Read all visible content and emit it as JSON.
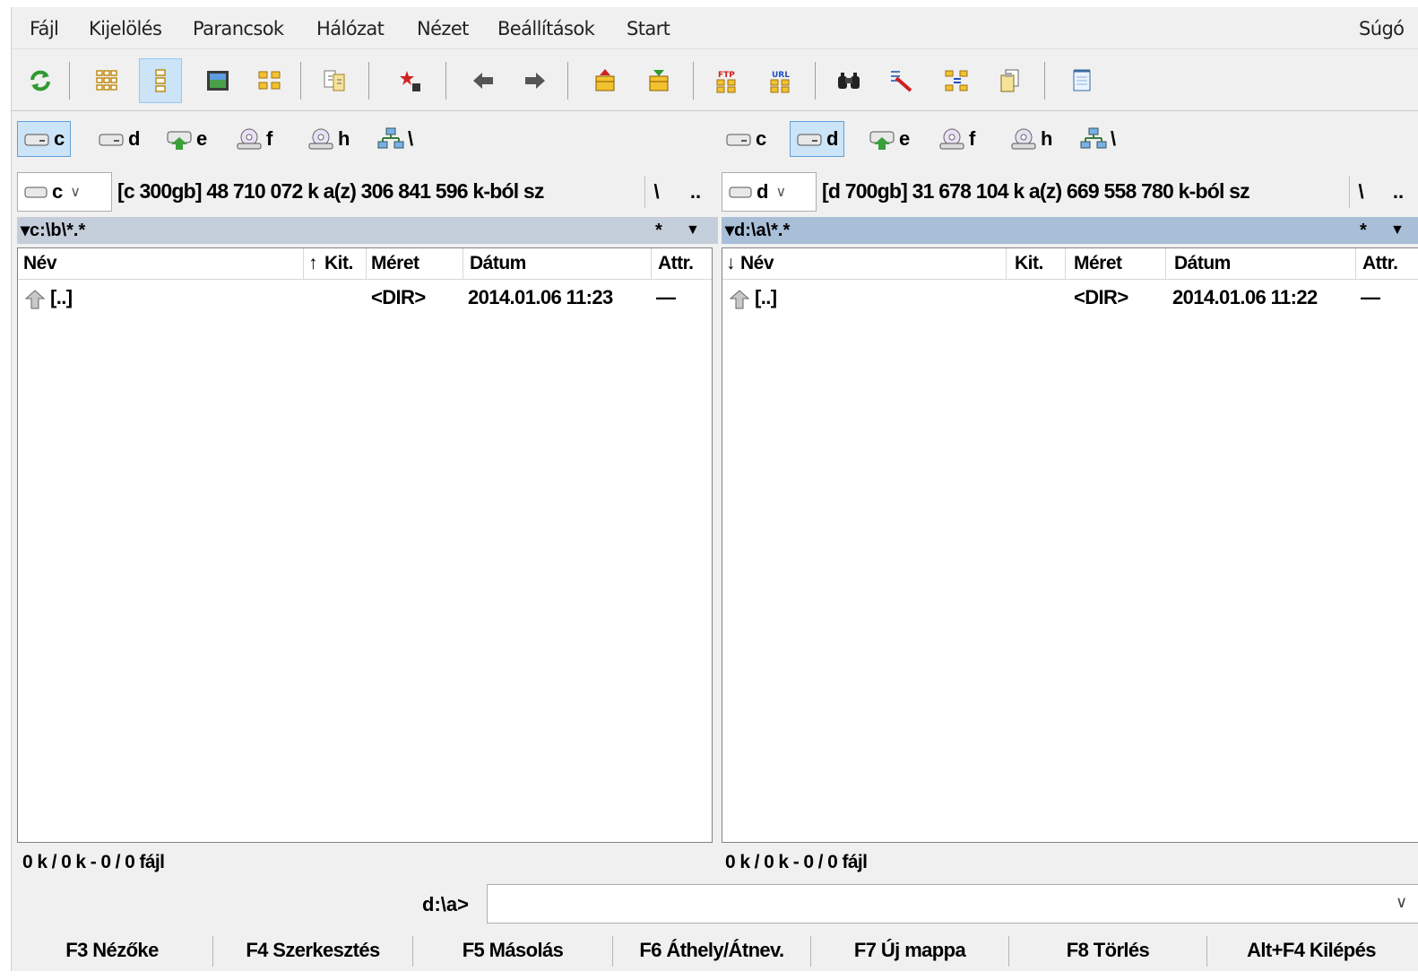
{
  "menu": [
    "Fájl",
    "Kijelölés",
    "Parancsok",
    "Hálózat",
    "Nézet",
    "Beállítások",
    "Start",
    "Súgó"
  ],
  "toolbar": {
    "icons": [
      "refresh-icon",
      "brief-view-icon",
      "detailed-view-icon",
      "thumbnail-view-icon",
      "tree-view-icon",
      "compare-icon",
      "select-icon",
      "back-icon",
      "forward-icon",
      "pack-icon",
      "unpack-icon",
      "ftp-icon",
      "url-icon",
      "search-icon",
      "rename-icon",
      "sync-icon",
      "copy-names-icon",
      "notepad-icon"
    ]
  },
  "left": {
    "drives": [
      {
        "letter": "c",
        "icon": "hdd-icon",
        "active": true
      },
      {
        "letter": "d",
        "icon": "hdd-icon",
        "active": false
      },
      {
        "letter": "e",
        "icon": "removable-drive-icon",
        "active": false
      },
      {
        "letter": "f",
        "icon": "cd-drive-icon",
        "active": false
      },
      {
        "letter": "h",
        "icon": "cd-drive-icon",
        "active": false
      },
      {
        "letter": "\\",
        "icon": "network-icon",
        "active": false
      }
    ],
    "combo_drive": "c",
    "info": "[c 300gb]  48 710 072 k a(z) 306 841 596 k-ból sz",
    "root_btn": "\\",
    "up_btn": "..",
    "path": "▾c:\\b\\*.*",
    "filter": "*",
    "columns": {
      "name": "Név",
      "ext": "Kit.",
      "size": "Méret",
      "date": "Dátum",
      "attr": "Attr."
    },
    "sort_indicator": "ext-asc",
    "rows": [
      {
        "name": "[..]",
        "size": "<DIR>",
        "date": "2014.01.06 11:23",
        "attr": "—"
      }
    ],
    "status": "0 k / 0 k - 0 / 0 fájl"
  },
  "right": {
    "drives": [
      {
        "letter": "c",
        "icon": "hdd-icon",
        "active": false
      },
      {
        "letter": "d",
        "icon": "hdd-icon",
        "active": true
      },
      {
        "letter": "e",
        "icon": "removable-drive-icon",
        "active": false
      },
      {
        "letter": "f",
        "icon": "cd-drive-icon",
        "active": false
      },
      {
        "letter": "h",
        "icon": "cd-drive-icon",
        "active": false
      },
      {
        "letter": "\\",
        "icon": "network-icon",
        "active": false
      }
    ],
    "combo_drive": "d",
    "info": "[d 700gb]  31 678 104 k a(z) 669 558 780 k-ból sz",
    "root_btn": "\\",
    "up_btn": "..",
    "path": "▾d:\\a\\*.*",
    "filter": "*",
    "columns": {
      "name": "Név",
      "ext": "Kit.",
      "size": "Méret",
      "date": "Dátum",
      "attr": "Attr."
    },
    "sort_indicator": "name-desc",
    "rows": [
      {
        "name": "[..]",
        "size": "<DIR>",
        "date": "2014.01.06 11:22",
        "attr": "—"
      }
    ],
    "status": "0 k / 0 k - 0 / 0 fájl"
  },
  "cmdline": {
    "prompt": "d:\\a>",
    "value": ""
  },
  "fkeys": [
    "F3 Nézőke",
    "F4 Szerkesztés",
    "F5 Másolás",
    "F6 Áthely/Átnev.",
    "F7 Új mappa",
    "F8 Törlés",
    "Alt+F4 Kilépés"
  ],
  "colors": {
    "active_path": "#a9bfd8",
    "inactive_path": "#c4cedb",
    "highlight": "#cce4f7"
  }
}
